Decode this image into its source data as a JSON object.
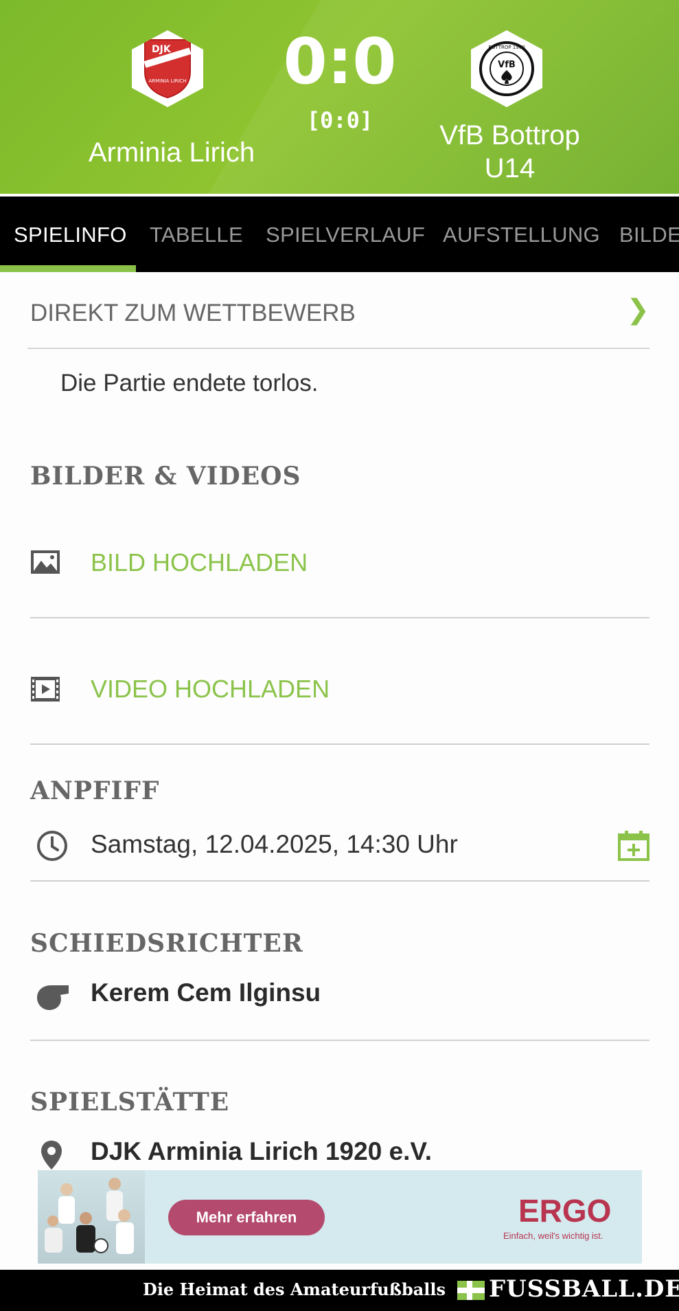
{
  "header": {
    "home_team": "Arminia Lirich",
    "away_team": "VfB Bottrop U14",
    "score": "0:0",
    "halftime": "[0:0]",
    "home_logo_text": "DJK",
    "home_logo_subtext": "ARMINIA LIRICH",
    "away_logo_text": "VfB",
    "away_logo_subtext": "BOTTROP 1900",
    "accent_color": "#8bc34a"
  },
  "tabs": [
    "SPIELINFO",
    "TABELLE",
    "SPIELVERLAUF",
    "AUFSTELLUNG",
    "BILDE"
  ],
  "competition_link": {
    "label": "DIREKT ZUM WETTBEWERB",
    "chevron": "❯"
  },
  "summary": "Die Partie endete torlos.",
  "media": {
    "title": "BILDER & VIDEOS",
    "upload_image": "BILD HOCHLADEN",
    "upload_video": "VIDEO HOCHLADEN"
  },
  "kickoff": {
    "title": "ANPFIFF",
    "datetime": "Samstag, 12.04.2025, 14:30 Uhr"
  },
  "referee": {
    "title": "SCHIEDSRICHTER",
    "name": "Kerem Cem Ilginsu"
  },
  "venue": {
    "title": "SPIELSTÄTTE",
    "name": "DJK Arminia Lirich 1920 e.V."
  },
  "ad": {
    "button": "Mehr erfahren",
    "brand": "ERGO",
    "slogan": "Einfach, weil's wichtig ist."
  },
  "footer": {
    "tagline": "Die Heimat des Amateurfußballs",
    "brand": "FUSSBALL.DE"
  }
}
